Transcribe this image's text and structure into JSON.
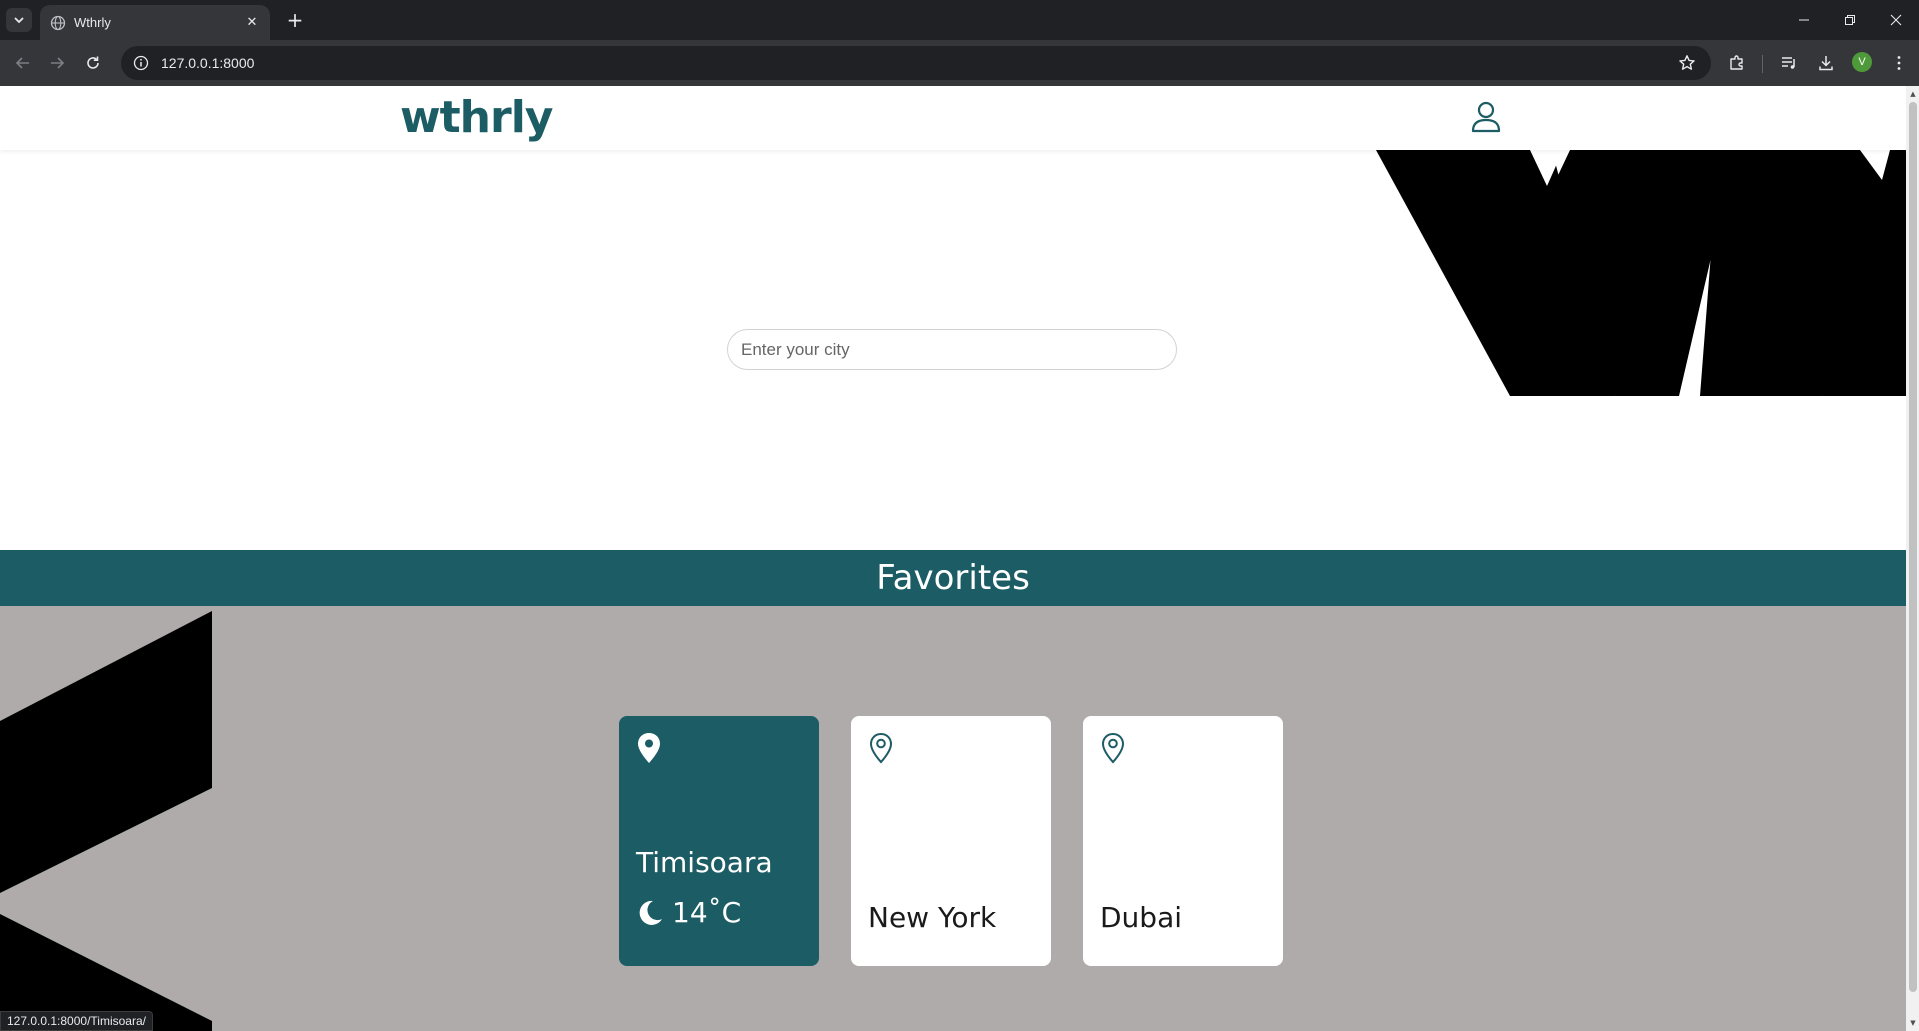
{
  "browser": {
    "tab_title": "Wthrly",
    "url": "127.0.0.1:8000",
    "profile_initial": "V",
    "status_url": "127.0.0.1:8000/Timisoara/"
  },
  "site": {
    "logo": "wthrly",
    "search_placeholder": "Enter your city",
    "favorites_title": "Favorites",
    "favorites": [
      {
        "city": "Timisoara",
        "temperature": "14˚C",
        "weather_icon": "moon-icon",
        "active": true
      },
      {
        "city": "New York",
        "active": false
      },
      {
        "city": "Dubai",
        "active": false
      }
    ]
  },
  "colors": {
    "brand": "#1c5c64",
    "favorites_bg": "#b0abab",
    "shape": "#000000"
  }
}
